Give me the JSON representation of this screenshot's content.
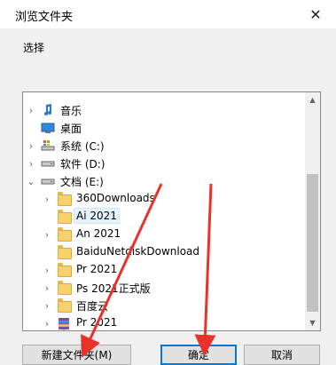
{
  "window": {
    "title": "浏览文件夹",
    "close_glyph": "✕"
  },
  "prompt": "选择",
  "tree": [
    {
      "label": "音乐",
      "icon": "music-icon",
      "expander": "›",
      "selected": false
    },
    {
      "label": "桌面",
      "icon": "desktop-icon",
      "expander": "",
      "selected": false
    },
    {
      "label": "系统 (C:)",
      "icon": "system-drive-icon",
      "expander": "›",
      "selected": false
    },
    {
      "label": "软件 (D:)",
      "icon": "drive-icon",
      "expander": "›",
      "selected": false
    },
    {
      "label": "文档 (E:)",
      "icon": "drive-icon",
      "expander": "⌄",
      "selected": false
    },
    {
      "label": "360Downloads",
      "icon": "folder-icon",
      "expander": "›",
      "selected": false
    },
    {
      "label": "Ai 2021",
      "icon": "folder-icon",
      "expander": "",
      "selected": true
    },
    {
      "label": "An 2021",
      "icon": "folder-icon",
      "expander": "›",
      "selected": false
    },
    {
      "label": "BaiduNetdiskDownload",
      "icon": "folder-icon",
      "expander": "",
      "selected": false
    },
    {
      "label": "Pr 2021",
      "icon": "folder-icon",
      "expander": "›",
      "selected": false
    },
    {
      "label": "Ps 2021正式版",
      "icon": "folder-icon",
      "expander": "›",
      "selected": false
    },
    {
      "label": "百度云",
      "icon": "folder-icon",
      "expander": "›",
      "selected": false
    },
    {
      "label": "Pr 2021",
      "icon": "archive-icon",
      "expander": "›",
      "selected": false
    }
  ],
  "buttons": {
    "new_folder": "新建文件夹(M)",
    "ok": "确定",
    "cancel": "取消"
  },
  "colors": {
    "annotation_arrow": "#e8322a",
    "selection": "#e5f3ff",
    "accent": "#0078d7"
  }
}
